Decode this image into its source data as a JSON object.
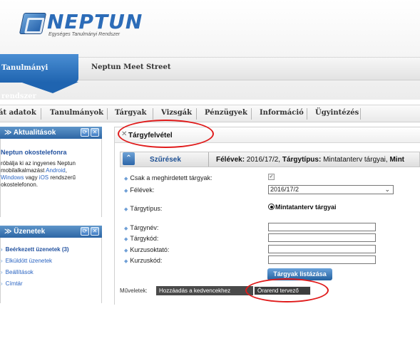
{
  "header": {
    "logo_name": "NEPTUN",
    "logo_subtitle": "Egységes Tanulmányi Rendszer",
    "system_tab": "Tanulmányi rendszer",
    "meet_street": "Neptun Meet Street"
  },
  "mainnav": {
    "items": [
      "át adatok",
      "Tanulmányok",
      "Tárgyak",
      "Vizsgák",
      "Pénzügyek",
      "Információ",
      "Ügyintézés"
    ]
  },
  "news_panel": {
    "title": "Aktualitások",
    "item_title": "Neptun okostelefonra",
    "line1": "róbálja ki az ingyenes Neptun",
    "line2": "mobilalkalmazást",
    "link_android": "Android",
    "line3_suffix": ",",
    "link_windows_prefix": "Windows",
    "line4_mid": " vagy ",
    "link_ios": "iOS",
    "line4_suffix": " rendszerű",
    "line5": "okostelefonon."
  },
  "messages_panel": {
    "title": "Üzenetek",
    "items": [
      {
        "label": "Beérkezett üzenetek (3)"
      },
      {
        "label": "Elküldött üzenetek"
      },
      {
        "label": "Beállítások"
      },
      {
        "label": "Címtár"
      }
    ]
  },
  "content": {
    "title": "Tárgyfelvétel",
    "filter_title": "Szűrések",
    "filter_summary_prefix": "Félévek:",
    "filter_summary_semester": " 2016/17/2, ",
    "filter_summary_type_label": "Tárgytípus:",
    "filter_summary_type": " Mintatanterv tárgyai, ",
    "filter_summary_more": "Mint",
    "labels": {
      "offered_only": "Csak a meghirdetett tárgyak:",
      "semesters": "Félévek:",
      "course_type": "Tárgytípus:",
      "course_name": "Tárgynév:",
      "course_code": "Tárgykód:",
      "course_teacher": "Kurzusoktató:",
      "course_code2": "Kurzuskód:"
    },
    "offered_only_checked": true,
    "semester_value": "2016/17/2",
    "course_type_option": "Mintatanterv tárgyai",
    "list_button": "Tárgyak listázása",
    "operations_label": "Műveletek:",
    "add_favorites_button": "Hozzáadás a kedvencekhez",
    "timetable_planner_button": "Órarend tervező"
  },
  "icons": {
    "panel_refresh": "refresh-icon",
    "panel_close": "close-icon",
    "collapse": "chevron-up-icon",
    "tab_close": "close-icon"
  },
  "colors": {
    "accent_blue": "#2d66a5",
    "annotation_red": "#e01b1b"
  }
}
